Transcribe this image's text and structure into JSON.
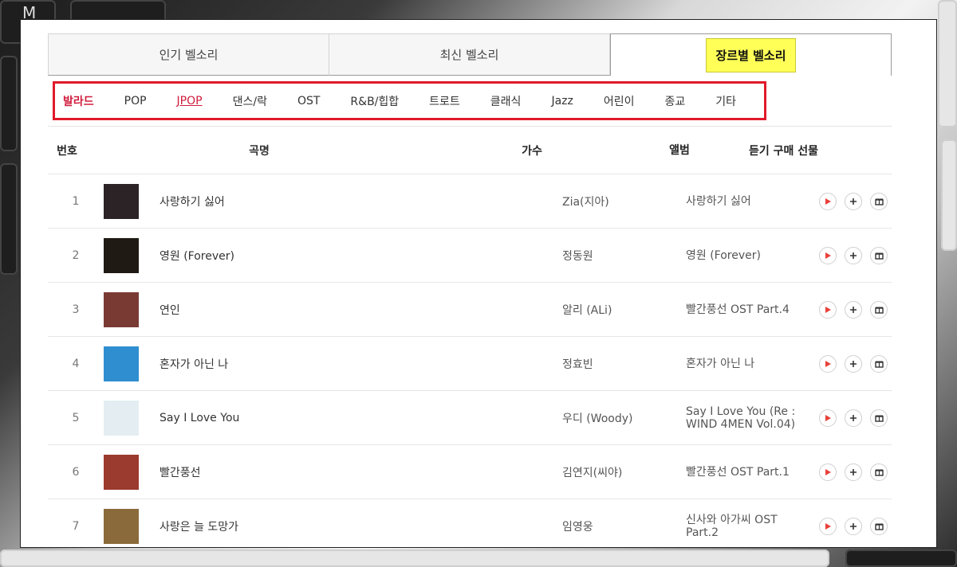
{
  "tabs": [
    {
      "label": "인기 벨소리",
      "active": false
    },
    {
      "label": "최신 벨소리",
      "active": false
    },
    {
      "label": "장르별 벨소리",
      "active": true
    }
  ],
  "genres": [
    {
      "label": "발라드",
      "state": "selected"
    },
    {
      "label": "POP",
      "state": "normal"
    },
    {
      "label": "JPOP",
      "state": "linked"
    },
    {
      "label": "댄스/락",
      "state": "normal"
    },
    {
      "label": "OST",
      "state": "normal"
    },
    {
      "label": "R&B/힙합",
      "state": "normal"
    },
    {
      "label": "트로트",
      "state": "normal"
    },
    {
      "label": "클래식",
      "state": "normal"
    },
    {
      "label": "Jazz",
      "state": "normal"
    },
    {
      "label": "어린이",
      "state": "normal"
    },
    {
      "label": "종교",
      "state": "normal"
    },
    {
      "label": "기타",
      "state": "normal"
    }
  ],
  "table": {
    "headers": {
      "no": "번호",
      "title": "곡명",
      "artist": "가수",
      "album": "앨범",
      "actions": "듣기 구매 선물"
    },
    "rows": [
      {
        "no": "1",
        "title": "사랑하기 싫어",
        "artist": "Zia(지아)",
        "album": "사랑하기 싫어",
        "thumb_color": "#2b2326"
      },
      {
        "no": "2",
        "title": "영원 (Forever)",
        "artist": "정동원",
        "album": "영원 (Forever)",
        "thumb_color": "#1f1b14"
      },
      {
        "no": "3",
        "title": "연인",
        "artist": "알리 (ALi)",
        "album": "빨간풍선 OST Part.4",
        "thumb_color": "#7a3a34"
      },
      {
        "no": "4",
        "title": "혼자가 아닌 나",
        "artist": "정효빈",
        "album": "혼자가 아닌 나",
        "thumb_color": "#2f8ed0"
      },
      {
        "no": "5",
        "title": "Say I Love You",
        "artist": "우디 (Woody)",
        "album": "Say I Love You (Re : WIND 4MEN Vol.04)",
        "thumb_color": "#e4eef2"
      },
      {
        "no": "6",
        "title": "빨간풍선",
        "artist": "김연지(씨야)",
        "album": "빨간풍선 OST Part.1",
        "thumb_color": "#9b3a2e"
      },
      {
        "no": "7",
        "title": "사랑은 늘 도망가",
        "artist": "임영웅",
        "album": "신사와 아가씨 OST Part.2",
        "thumb_color": "#8a6a3a"
      }
    ]
  },
  "icons": {
    "play": "play-icon",
    "add": "plus-icon",
    "gift": "gift-icon"
  },
  "colors": {
    "accent_red": "#d01c3c",
    "highlight_box": "#e01a2a",
    "active_tab_yellow": "#ffff58",
    "play_red": "#e8413a"
  }
}
